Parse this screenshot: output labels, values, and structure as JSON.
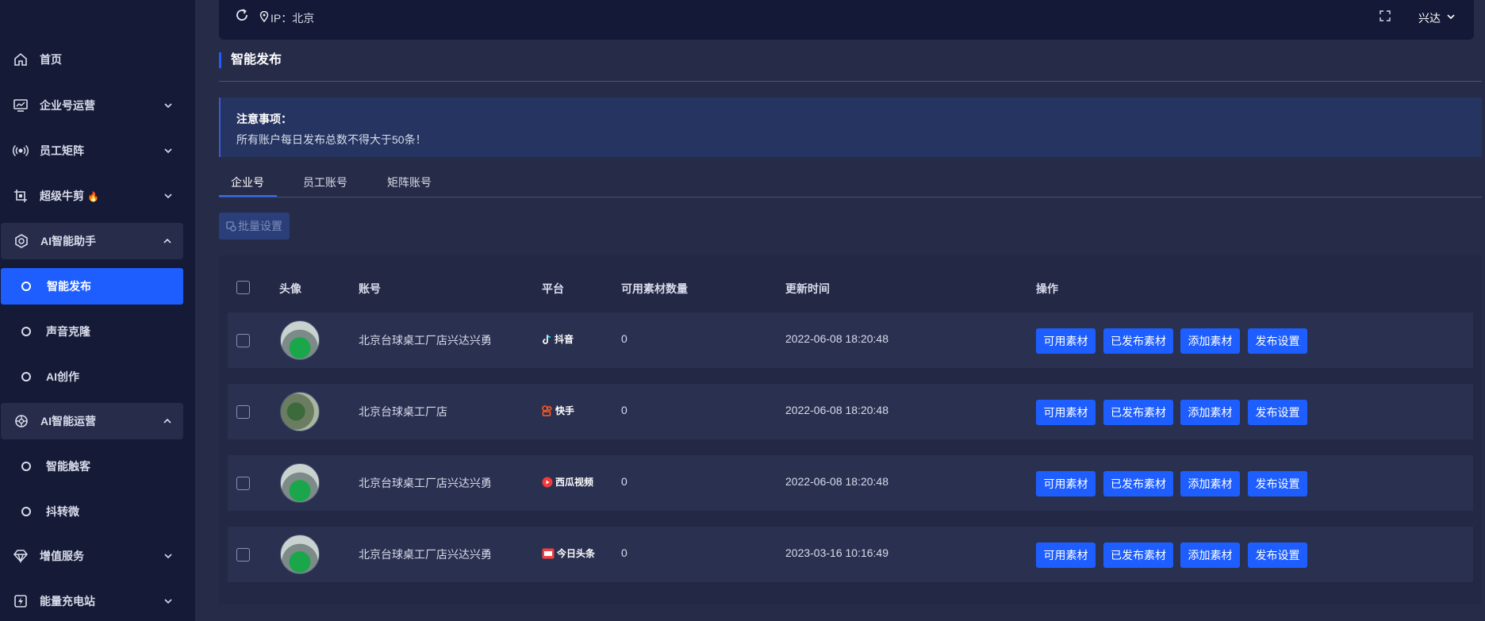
{
  "sidebar": {
    "items": [
      {
        "label": "首页",
        "icon": "home-icon"
      },
      {
        "label": "企业号运营",
        "icon": "monitor-chart-icon"
      },
      {
        "label": "员工矩阵",
        "icon": "broadcast-icon"
      },
      {
        "label": "超级牛剪",
        "icon": "crop-icon",
        "badge": "🔥"
      },
      {
        "label": "AI智能助手",
        "icon": "ai-brain-icon"
      },
      {
        "label": "智能发布"
      },
      {
        "label": "声音克隆"
      },
      {
        "label": "AI创作"
      },
      {
        "label": "AI智能运营",
        "icon": "ai-network-icon"
      },
      {
        "label": "智能触客"
      },
      {
        "label": "抖转微"
      },
      {
        "label": "增值服务",
        "icon": "diamond-icon"
      },
      {
        "label": "能量充电站",
        "icon": "charging-icon"
      }
    ]
  },
  "topbar": {
    "ip_text": "IP：北京",
    "user_name": "兴达"
  },
  "page": {
    "title": "智能发布",
    "notice_title": "注意事项：",
    "notice_text": "所有账户每日发布总数不得大于50条！"
  },
  "tabs": [
    "企业号",
    "员工账号",
    "矩阵账号"
  ],
  "batch_button": "批量设置",
  "table": {
    "headers": [
      "头像",
      "账号",
      "平台",
      "可用素材数量",
      "更新时间",
      "操作"
    ],
    "actions": [
      "可用素材",
      "已发布素材",
      "添加素材",
      "发布设置"
    ],
    "rows": [
      {
        "account": "北京台球桌工厂店兴达兴勇",
        "platform": "抖音",
        "count": "0",
        "updated": "2022-06-08 18:20:48"
      },
      {
        "account": "北京台球桌工厂店",
        "platform": "快手",
        "count": "0",
        "updated": "2022-06-08 18:20:48"
      },
      {
        "account": "北京台球桌工厂店兴达兴勇",
        "platform": "西瓜视频",
        "count": "0",
        "updated": "2022-06-08 18:20:48"
      },
      {
        "account": "北京台球桌工厂店兴达兴勇",
        "platform": "今日头条",
        "count": "0",
        "updated": "2023-03-16 10:16:49"
      }
    ]
  },
  "colors": {
    "accent": "#1e5eff",
    "sidebar_bg": "#151a36",
    "page_bg": "#262b47"
  }
}
